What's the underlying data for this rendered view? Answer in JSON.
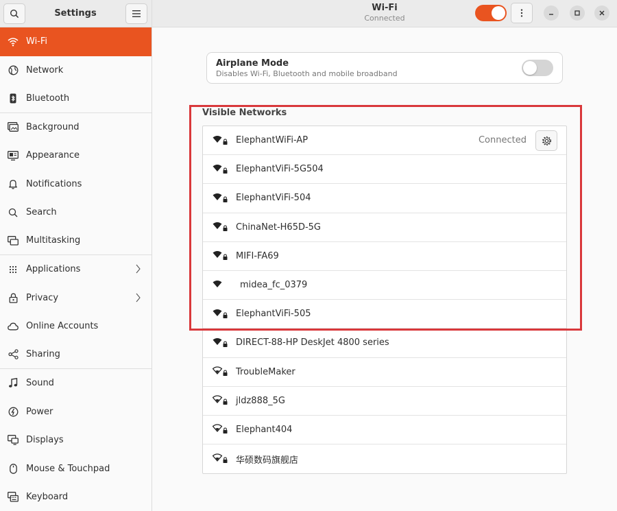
{
  "sidebar": {
    "title": "Settings",
    "items": [
      {
        "label": "Wi-Fi",
        "icon": "wifi-icon",
        "active": true
      },
      {
        "label": "Network",
        "icon": "network-icon"
      },
      {
        "label": "Bluetooth",
        "icon": "bluetooth-icon"
      },
      {
        "label": "Background",
        "icon": "background-icon"
      },
      {
        "label": "Appearance",
        "icon": "appearance-icon"
      },
      {
        "label": "Notifications",
        "icon": "bell-icon"
      },
      {
        "label": "Search",
        "icon": "search-icon"
      },
      {
        "label": "Multitasking",
        "icon": "multitasking-icon"
      },
      {
        "label": "Applications",
        "icon": "applications-icon",
        "arrow": true
      },
      {
        "label": "Privacy",
        "icon": "lock-icon",
        "arrow": true
      },
      {
        "label": "Online Accounts",
        "icon": "cloud-icon"
      },
      {
        "label": "Sharing",
        "icon": "share-icon"
      },
      {
        "label": "Sound",
        "icon": "music-note-icon"
      },
      {
        "label": "Power",
        "icon": "power-icon"
      },
      {
        "label": "Displays",
        "icon": "display-icon"
      },
      {
        "label": "Mouse & Touchpad",
        "icon": "mouse-icon"
      },
      {
        "label": "Keyboard",
        "icon": "keyboard-icon"
      }
    ]
  },
  "header": {
    "title": "Wi-Fi",
    "subtitle": "Connected",
    "wifi_enabled": true
  },
  "airplane": {
    "title": "Airplane Mode",
    "subtitle": "Disables Wi-Fi, Bluetooth and mobile broadband",
    "enabled": false
  },
  "networks": {
    "title": "Visible Networks",
    "items": [
      {
        "name": "ElephantWiFi-AP",
        "status": "Connected",
        "strength": "full",
        "locked": true
      },
      {
        "name": "ElephantViFi-5G504",
        "strength": "full",
        "locked": true
      },
      {
        "name": "ElephantViFi-504",
        "strength": "full",
        "locked": true
      },
      {
        "name": "ChinaNet-H65D-5G",
        "strength": "full",
        "locked": true
      },
      {
        "name": "MIFI-FA69",
        "strength": "full",
        "locked": true
      },
      {
        "name": "midea_fc_0379",
        "strength": "full",
        "locked": false
      },
      {
        "name": "ElephantViFi-505",
        "strength": "full",
        "locked": true
      },
      {
        "name": "DIRECT-88-HP DeskJet 4800 series",
        "strength": "full",
        "locked": true
      },
      {
        "name": "TroubleMaker",
        "strength": "weak",
        "locked": true
      },
      {
        "name": "jldz888_5G",
        "strength": "weak",
        "locked": true
      },
      {
        "name": "Elephant404",
        "strength": "weak",
        "locked": true
      },
      {
        "name": "华硕数码旗舰店",
        "strength": "weak",
        "locked": true
      }
    ]
  },
  "colors": {
    "accent": "#e95420",
    "highlight": "#d9383b"
  }
}
